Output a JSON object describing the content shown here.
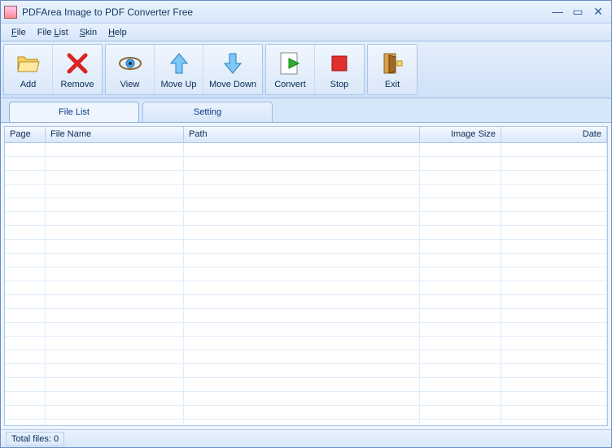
{
  "window": {
    "title": "PDFArea Image to PDF Converter Free"
  },
  "menu": {
    "file": "File",
    "filelist": "File List",
    "skin": "Skin",
    "help": "Help"
  },
  "toolbar": {
    "add": "Add",
    "remove": "Remove",
    "view": "View",
    "moveup": "Move Up",
    "movedown": "Move Down",
    "convert": "Convert",
    "stop": "Stop",
    "exit": "Exit"
  },
  "tabs": {
    "filelist": "File List",
    "setting": "Setting"
  },
  "columns": {
    "page": "Page",
    "fname": "File Name",
    "path": "Path",
    "size": "Image Size",
    "date": "Date"
  },
  "status": {
    "total": "Total files: 0"
  }
}
